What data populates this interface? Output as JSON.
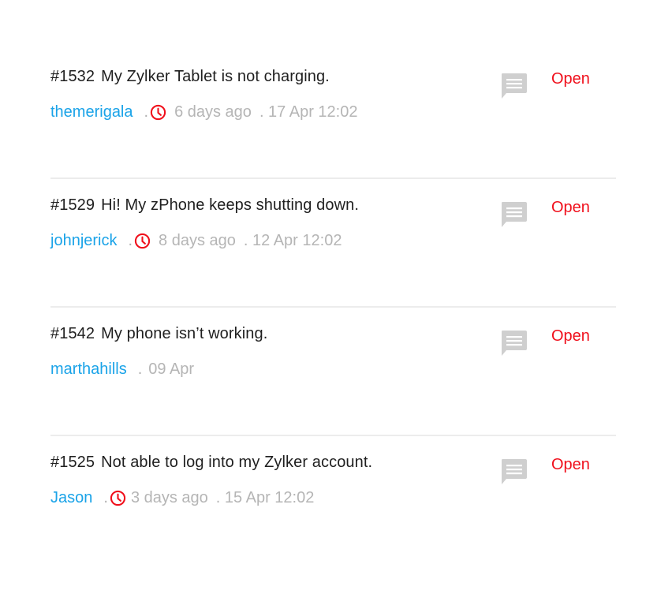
{
  "colors": {
    "requester": "#1aa3e8",
    "status_open": "#f0101c",
    "muted_text": "#b5b5b5",
    "title_text": "#1f1f1f",
    "divider": "#ececec",
    "comment_icon": "#cfcfcf"
  },
  "tickets": [
    {
      "id": "#1532",
      "subject": "My Zylker Tablet is not charging.",
      "requester": "themerigala",
      "separator": ".",
      "has_clock": true,
      "relative_time": "6 days ago",
      "absolute_time": ". 17 Apr 12:02",
      "status": "Open",
      "comment_icon": "comment-icon"
    },
    {
      "id": "#1529",
      "subject": "Hi! My zPhone keeps shutting down.",
      "requester": "johnjerick",
      "separator": ".",
      "has_clock": true,
      "relative_time": "8 days ago",
      "absolute_time": ". 12 Apr 12:02",
      "status": "Open",
      "comment_icon": "comment-icon"
    },
    {
      "id": "#1542",
      "subject": "My phone isn’t working.",
      "requester": "marthahills",
      "separator": ".",
      "has_clock": false,
      "relative_time": "",
      "absolute_time": "09 Apr",
      "status": "Open",
      "comment_icon": "comment-icon"
    },
    {
      "id": "#1525",
      "subject": "Not able to log into my Zylker account.",
      "requester": "Jason",
      "separator": ".",
      "has_clock": true,
      "relative_time": "3 days ago",
      "absolute_time": ". 15 Apr 12:02",
      "status": "Open",
      "comment_icon": "comment-icon"
    }
  ]
}
